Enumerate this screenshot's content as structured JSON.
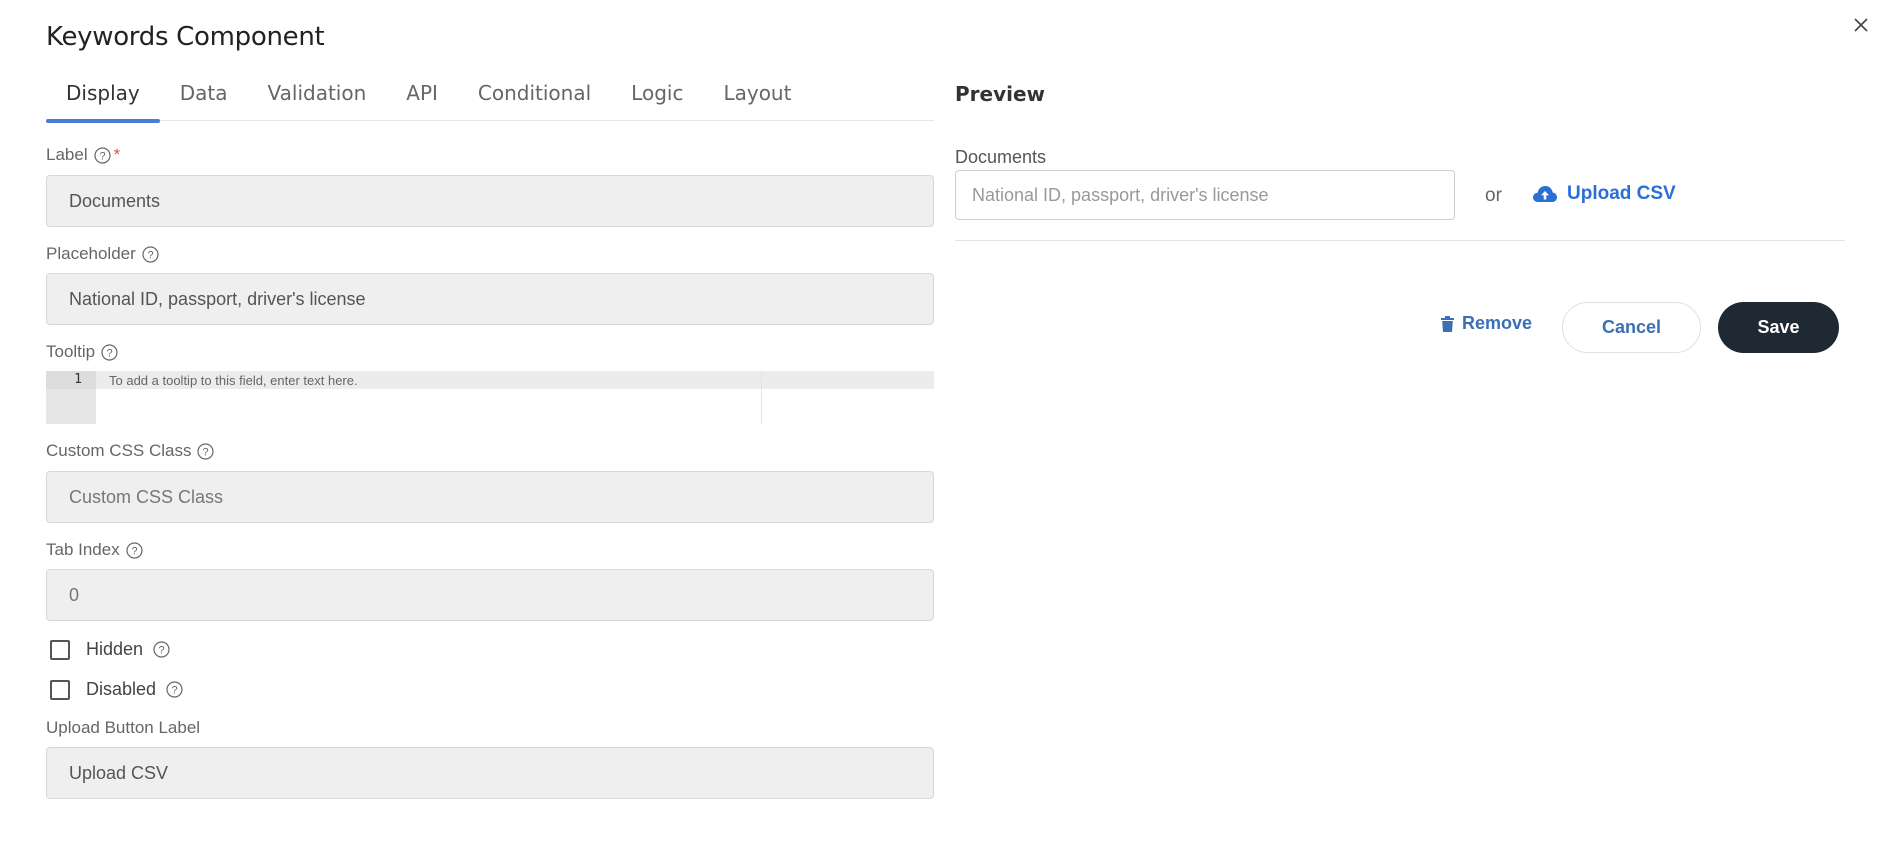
{
  "dialog": {
    "title": "Keywords Component",
    "close_icon": "close-icon"
  },
  "tabs": [
    {
      "label": "Display",
      "active": true
    },
    {
      "label": "Data",
      "active": false
    },
    {
      "label": "Validation",
      "active": false
    },
    {
      "label": "API",
      "active": false
    },
    {
      "label": "Conditional",
      "active": false
    },
    {
      "label": "Logic",
      "active": false
    },
    {
      "label": "Layout",
      "active": false
    }
  ],
  "form": {
    "label": {
      "label": "Label",
      "required_mark": "*",
      "value": "Documents"
    },
    "placeholder": {
      "label": "Placeholder",
      "value": "National ID, passport, driver's license"
    },
    "tooltip": {
      "label": "Tooltip",
      "line_number": "1",
      "placeholder": "To add a tooltip to this field, enter text here."
    },
    "custom_css": {
      "label": "Custom CSS Class",
      "placeholder": "Custom CSS Class"
    },
    "tab_index": {
      "label": "Tab Index",
      "placeholder": "0"
    },
    "hidden": {
      "label": "Hidden",
      "checked": false
    },
    "disabled": {
      "label": "Disabled",
      "checked": false
    },
    "upload_button_label": {
      "label": "Upload Button Label",
      "value": "Upload CSV"
    }
  },
  "preview": {
    "title": "Preview",
    "field_label": "Documents",
    "field_placeholder": "National ID, passport, driver's license",
    "or_text": "or",
    "upload_label": "Upload CSV",
    "upload_icon": "cloud-upload-icon"
  },
  "actions": {
    "remove": "Remove",
    "cancel": "Cancel",
    "save": "Save"
  },
  "colors": {
    "accent": "#4a7bd8",
    "link": "#2a6fd6",
    "save_bg": "#1f2933",
    "required": "#d9534f"
  }
}
